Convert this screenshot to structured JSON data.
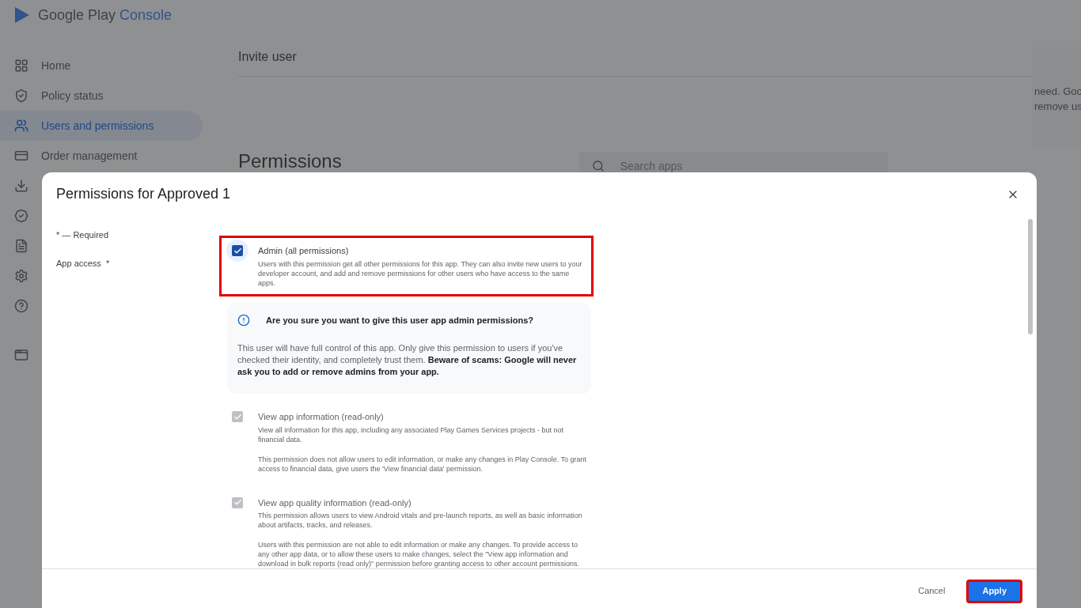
{
  "brand": {
    "name": "Google Play ",
    "product": "Console"
  },
  "sidebar": {
    "items": [
      {
        "kind": "home",
        "label": "Home",
        "selected": false
      },
      {
        "kind": "shield",
        "label": "Policy status",
        "selected": false
      },
      {
        "kind": "users",
        "label": "Users and permissions",
        "selected": true
      },
      {
        "kind": "card",
        "label": "Order management",
        "selected": false
      },
      {
        "kind": "download",
        "selected": false
      },
      {
        "kind": "badge",
        "selected": false
      },
      {
        "kind": "doc",
        "selected": false
      },
      {
        "kind": "gear",
        "selected": false
      },
      {
        "kind": "help",
        "selected": false
      },
      {
        "kind": "window",
        "selected": false
      }
    ]
  },
  "page": {
    "section_title": "Invite user",
    "side_note": [
      "need. Goo",
      "remove us"
    ],
    "permissions_title": "Permissions",
    "search": {
      "placeholder": "Search apps"
    }
  },
  "dialog": {
    "title": "Permissions for Approved 1",
    "required_note": "* — Required",
    "field_label": "App access  *",
    "permissions": [
      {
        "label": "Admin (all permissions)",
        "checked": true,
        "disabled": false,
        "highlighted": true,
        "description": [
          "Users with this permission get all other permissions for this app. They can also invite new users to your developer account, and add and remove permissions for other users who have access to the same apps."
        ],
        "warning": {
          "title": "Are you sure you want to give this user app admin permissions?",
          "body": "This user will have full control of this app. Only give this permission to users if you've checked their identity, and completely trust them. **Beware of scams: Google will never ask you to add or remove admins from your app.**"
        }
      },
      {
        "label": "View app information (read-only)",
        "checked": true,
        "disabled": true,
        "highlighted": false,
        "description": [
          "View all information for this app, including any associated Play Games Services projects - but not financial data.",
          "This permission does not allow users to edit information, or make any changes in Play Console. To grant access to financial data, give users the 'View financial data' permission."
        ]
      },
      {
        "label": "View app quality information (read-only)",
        "checked": true,
        "disabled": true,
        "highlighted": false,
        "description": [
          "This permission allows users to view Android vitals and pre-launch reports, as well as basic information about artifacts, tracks, and releases.",
          "Users with this permission are not able to edit information or make any changes. To provide access to any other app data, or to allow these users to make changes, select the \"View app information and download in bulk reports (read only)\" permission before granting access to other account permissions."
        ]
      }
    ],
    "buttons": [
      {
        "kind": "text",
        "label": "Cancel",
        "highlighted": false
      },
      {
        "kind": "primary",
        "label": "Apply",
        "highlighted": true
      }
    ]
  }
}
